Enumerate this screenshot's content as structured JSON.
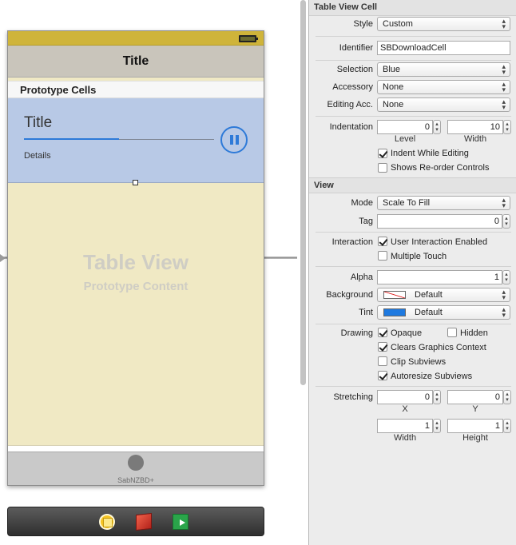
{
  "canvas": {
    "nav_title": "Title",
    "section_header": "Prototype Cells",
    "cell": {
      "title": "Title",
      "details": "Details",
      "progress": 0.5
    },
    "watermark_title": "Table View",
    "watermark_subtitle": "Prototype Content",
    "tab_label": "SabNZBD+",
    "dock_icons": [
      "view-controller-icon",
      "first-responder-icon",
      "exit-icon"
    ]
  },
  "inspector": {
    "table_view_cell": {
      "header": "Table View Cell",
      "style": {
        "label": "Style",
        "value": "Custom"
      },
      "identifier": {
        "label": "Identifier",
        "value": "SBDownloadCell"
      },
      "selection": {
        "label": "Selection",
        "value": "Blue"
      },
      "accessory": {
        "label": "Accessory",
        "value": "None"
      },
      "editing_acc": {
        "label": "Editing Acc.",
        "value": "None"
      },
      "indentation": {
        "label": "Indentation",
        "level": "0",
        "width": "10",
        "level_label": "Level",
        "width_label": "Width"
      },
      "indent_while_editing": {
        "label": "Indent While Editing",
        "checked": true
      },
      "shows_reorder": {
        "label": "Shows Re-order Controls",
        "checked": false
      }
    },
    "view": {
      "header": "View",
      "mode": {
        "label": "Mode",
        "value": "Scale To Fill"
      },
      "tag": {
        "label": "Tag",
        "value": "0"
      },
      "interaction": {
        "label": "Interaction",
        "user_interaction": {
          "label": "User Interaction Enabled",
          "checked": true
        },
        "multiple_touch": {
          "label": "Multiple Touch",
          "checked": false
        }
      },
      "alpha": {
        "label": "Alpha",
        "value": "1"
      },
      "background": {
        "label": "Background",
        "value": "Default"
      },
      "tint": {
        "label": "Tint",
        "value": "Default",
        "color": "#1f7ae0"
      },
      "drawing": {
        "label": "Drawing",
        "opaque": {
          "label": "Opaque",
          "checked": true
        },
        "hidden": {
          "label": "Hidden",
          "checked": false
        },
        "clears_graphics": {
          "label": "Clears Graphics Context",
          "checked": true
        },
        "clip_subviews": {
          "label": "Clip Subviews",
          "checked": false
        },
        "autoresize": {
          "label": "Autoresize Subviews",
          "checked": true
        }
      },
      "stretching": {
        "label": "Stretching",
        "x": "0",
        "y": "0",
        "width": "1",
        "height": "1",
        "x_label": "X",
        "y_label": "Y",
        "width_label": "Width",
        "height_label": "Height"
      }
    }
  }
}
